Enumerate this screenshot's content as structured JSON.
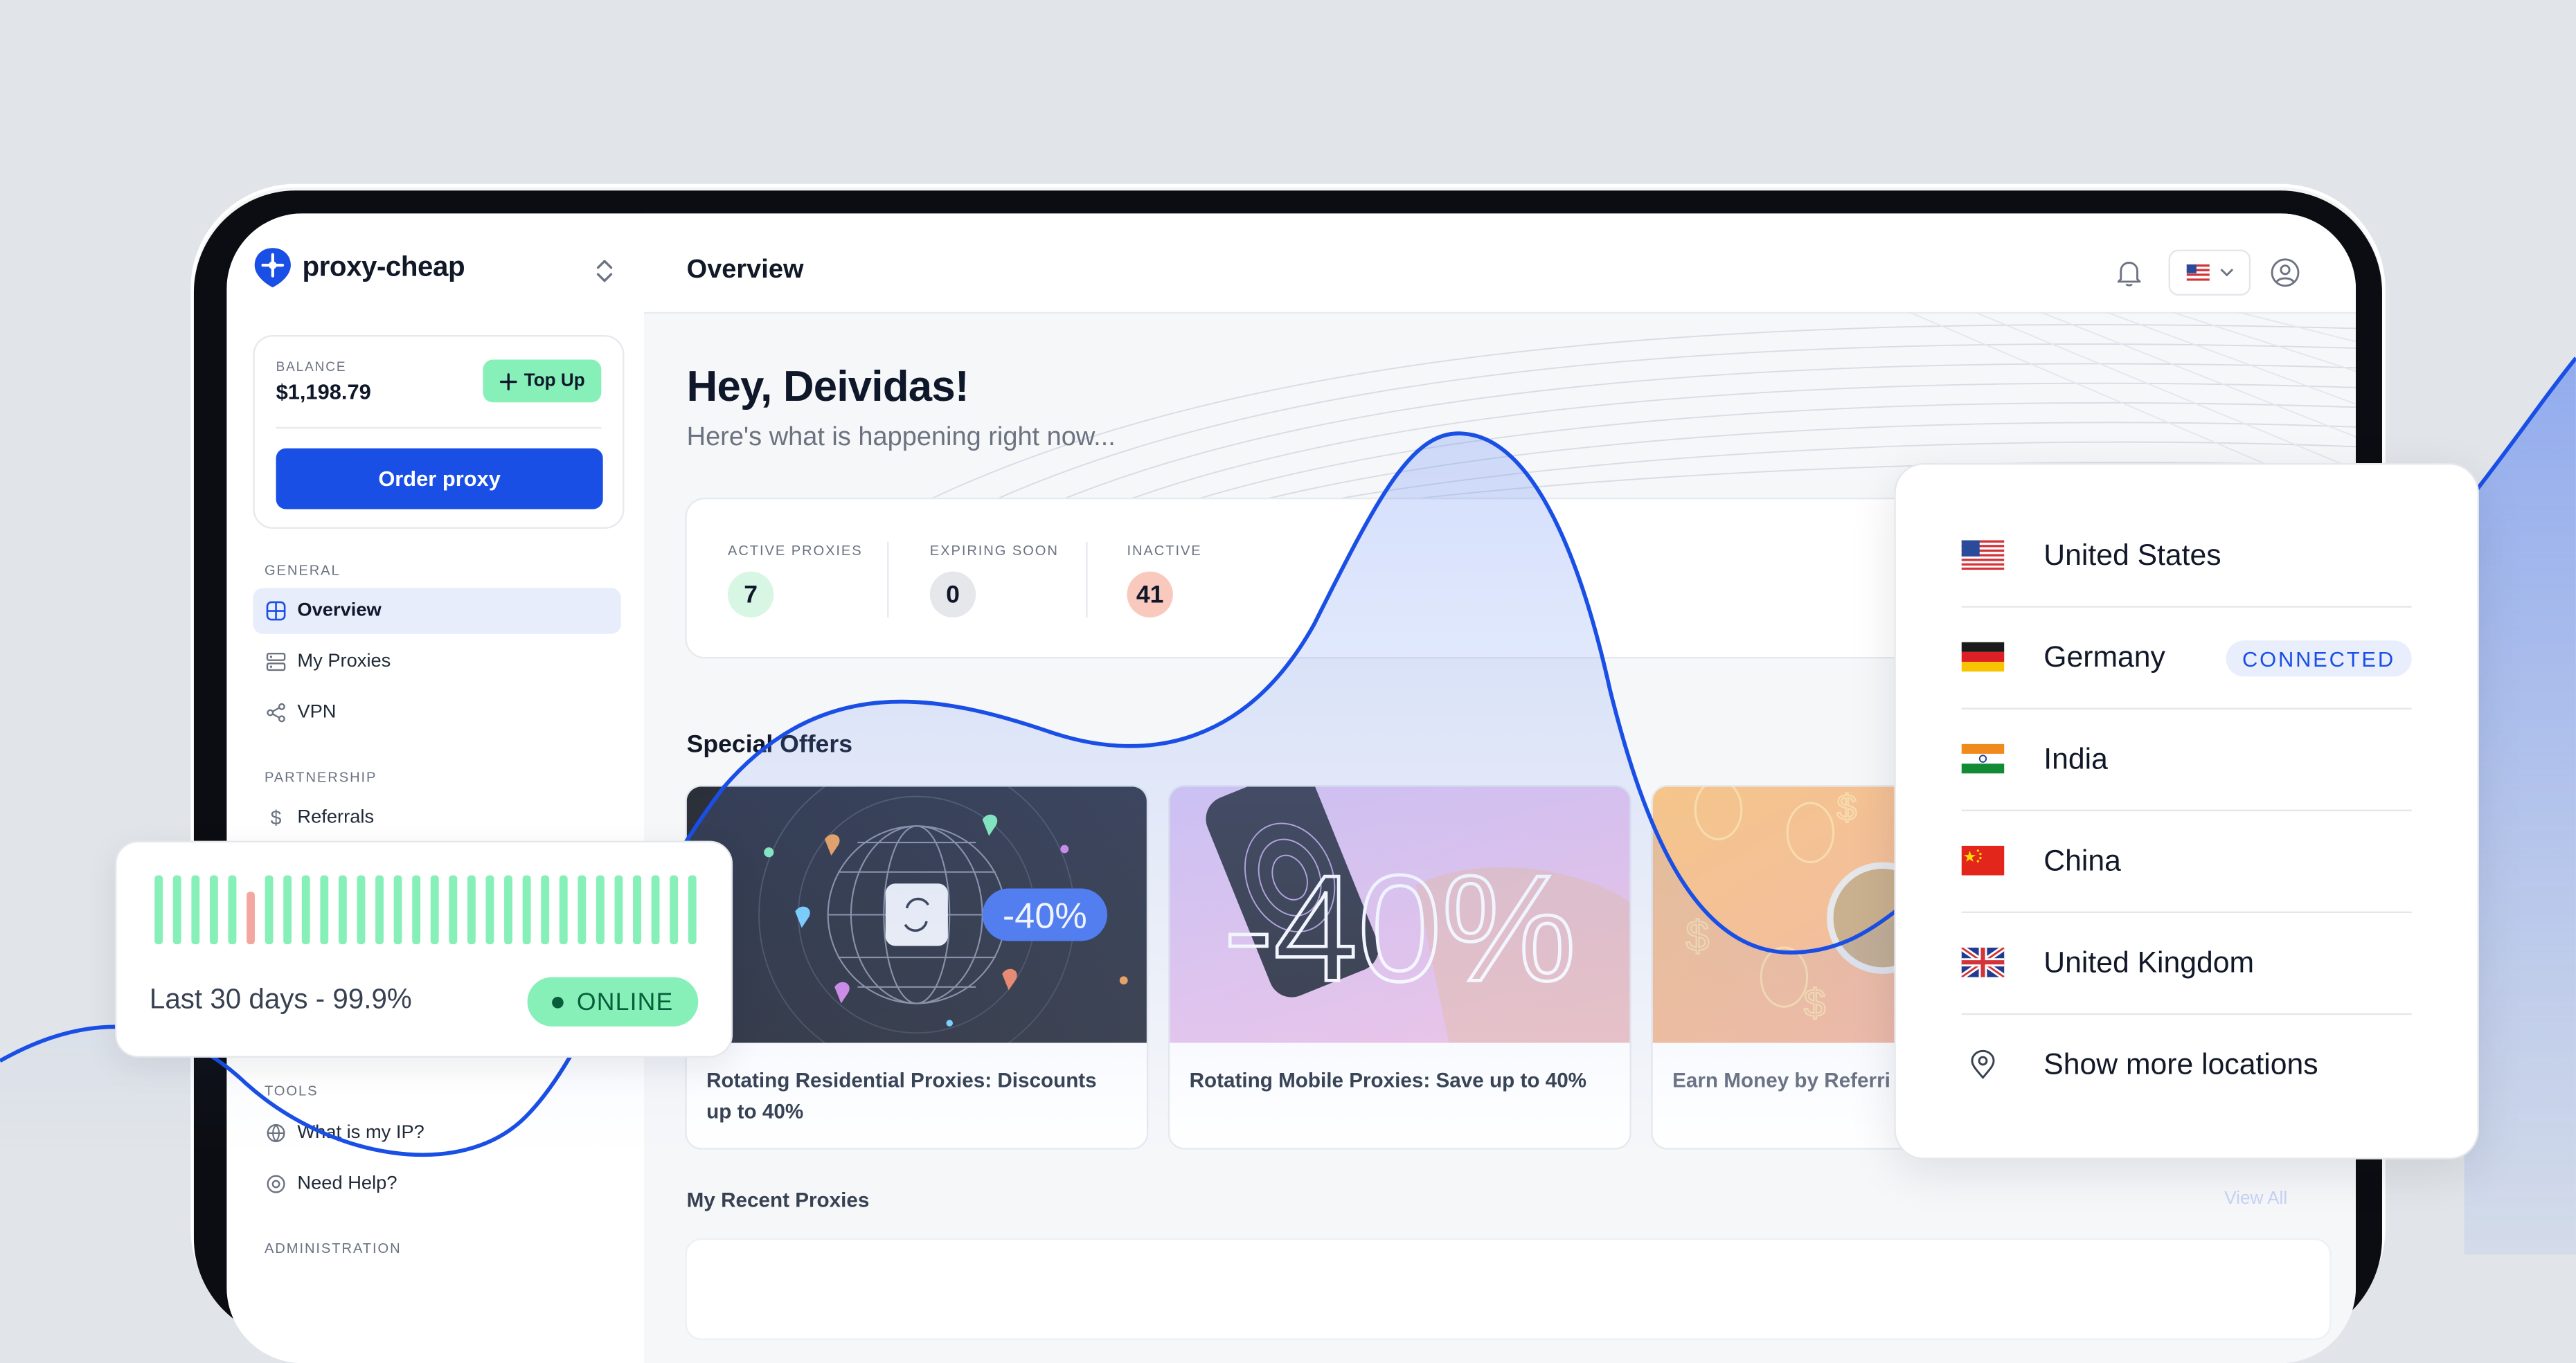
{
  "brand": {
    "name": "proxy-cheap"
  },
  "balance": {
    "label": "BALANCE",
    "value": "$1,198.79",
    "topup_label": "Top Up",
    "order_label": "Order proxy"
  },
  "nav": {
    "general_label": "GENERAL",
    "general": [
      {
        "label": "Overview",
        "icon": "grid-icon",
        "active": true
      },
      {
        "label": "My Proxies",
        "icon": "server-icon"
      },
      {
        "label": "VPN",
        "icon": "share-icon"
      }
    ],
    "partnership_label": "PARTNERSHIP",
    "partnership": [
      {
        "label": "Referrals",
        "icon": "dollar-icon"
      }
    ],
    "tools_label": "TOOLS",
    "tools": [
      {
        "label": "What is my IP?",
        "icon": "ip-icon"
      },
      {
        "label": "Need Help?",
        "icon": "help-icon"
      }
    ],
    "admin_label": "ADMINISTRATION"
  },
  "header": {
    "title": "Overview",
    "language_flag": "us-flag-icon"
  },
  "hero": {
    "greeting": "Hey, Deividas!",
    "subtitle": "Here's what is happening right now..."
  },
  "stats": [
    {
      "label": "ACTIVE PROXIES",
      "value": "7",
      "color": "#d7f7e4"
    },
    {
      "label": "EXPIRING SOON",
      "value": "0",
      "color": "#e5e7eb"
    },
    {
      "label": "INACTIVE",
      "value": "41",
      "color": "#f9c9bd"
    }
  ],
  "offers": {
    "title": "Special Offers",
    "items": [
      {
        "title": "Rotating Residential Proxies: Discounts up to 40%",
        "badge": "-40%"
      },
      {
        "title": "Rotating Mobile Proxies: Save up to 40%",
        "badge": "-40%"
      },
      {
        "title": "Earn Money by Referri"
      }
    ]
  },
  "recent": {
    "title": "My Recent Proxies",
    "view_all": "View All"
  },
  "uptime": {
    "text": "Last 30 days - 99.9%",
    "status": "ONLINE",
    "bars_ok": 29,
    "bars_warn_index": 5
  },
  "locations": {
    "items": [
      {
        "name": "United States",
        "flag": "us"
      },
      {
        "name": "Germany",
        "flag": "de",
        "badge": "CONNECTED"
      },
      {
        "name": "India",
        "flag": "in"
      },
      {
        "name": "China",
        "flag": "cn"
      },
      {
        "name": "United Kingdom",
        "flag": "uk"
      },
      {
        "name": "Show more locations",
        "flag": "pin"
      }
    ]
  },
  "colors": {
    "accent": "#1a4fe6",
    "online": "#86f0b8",
    "warn": "#f4a7a0"
  }
}
